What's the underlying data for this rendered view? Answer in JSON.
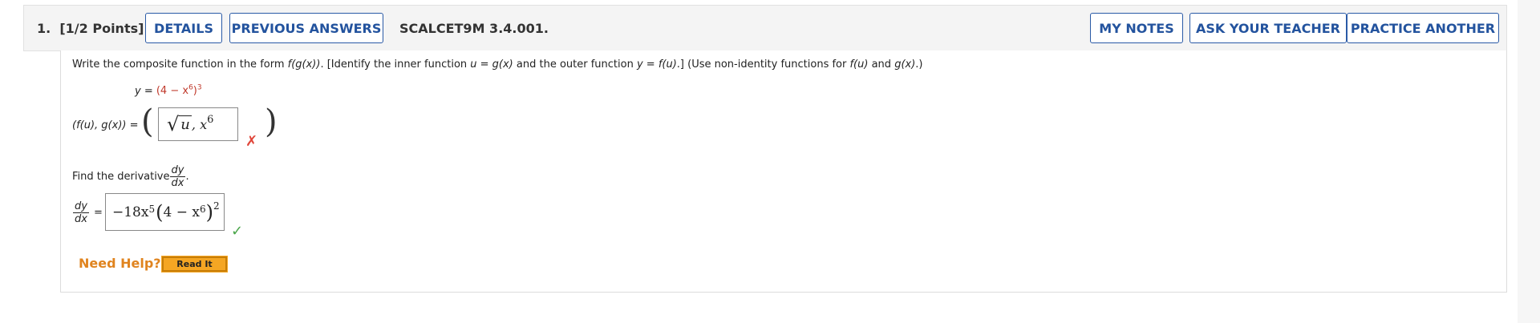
{
  "question": {
    "number_label": "1.",
    "points_label": "[1/2 Points]",
    "code": "SCALCET9M 3.4.001."
  },
  "header_buttons": {
    "details": "DETAILS",
    "previous_answers": "PREVIOUS ANSWERS",
    "my_notes": "MY NOTES",
    "ask_teacher": "ASK YOUR TEACHER",
    "practice_another": "PRACTICE ANOTHER"
  },
  "instruction": {
    "t1": "Write the composite function in the form ",
    "f_of_g": "f(g(x))",
    "t2": ". [Identify the inner function ",
    "u_eq": "u = g(x)",
    "t3": " and the outer function ",
    "y_eq": "y = f(u)",
    "t4": ".] (Use non-identity functions for ",
    "fu": "f(u)",
    "t5": " and ",
    "gx": "g(x)",
    "t6": ".)"
  },
  "given": {
    "lhs": "y = ",
    "rhs_base": "(4 − x",
    "rhs_exp_inner": "6",
    "rhs_close": ")",
    "rhs_exp_outer": "3"
  },
  "part1": {
    "label": "(f(u), g(x)) = ",
    "answer_u": "u",
    "answer_sep": " , x",
    "answer_exp": "6",
    "status": "incorrect"
  },
  "part2": {
    "prompt": "Find the derivative ",
    "frac_num": "dy",
    "frac_den": "dx",
    "period": ".",
    "lhs_num": "dy",
    "lhs_den": "dx",
    "eq": "=",
    "answer_coef": "−18x",
    "answer_exp1": "5",
    "answer_inner": "4 − x",
    "answer_exp2": "6",
    "answer_exp3": "2",
    "status": "correct"
  },
  "help": {
    "need_help": "Need Help?",
    "read_it": "Read It"
  },
  "colors": {
    "button_border": "#2a5aa6",
    "help_orange": "#e0841f",
    "read_it_bg": "#f5a623",
    "wrong": "#e0463a",
    "right": "#4aa64a",
    "given_red": "#c0392b"
  },
  "icons": {
    "incorrect": "x-mark-icon",
    "correct": "check-mark-icon"
  }
}
